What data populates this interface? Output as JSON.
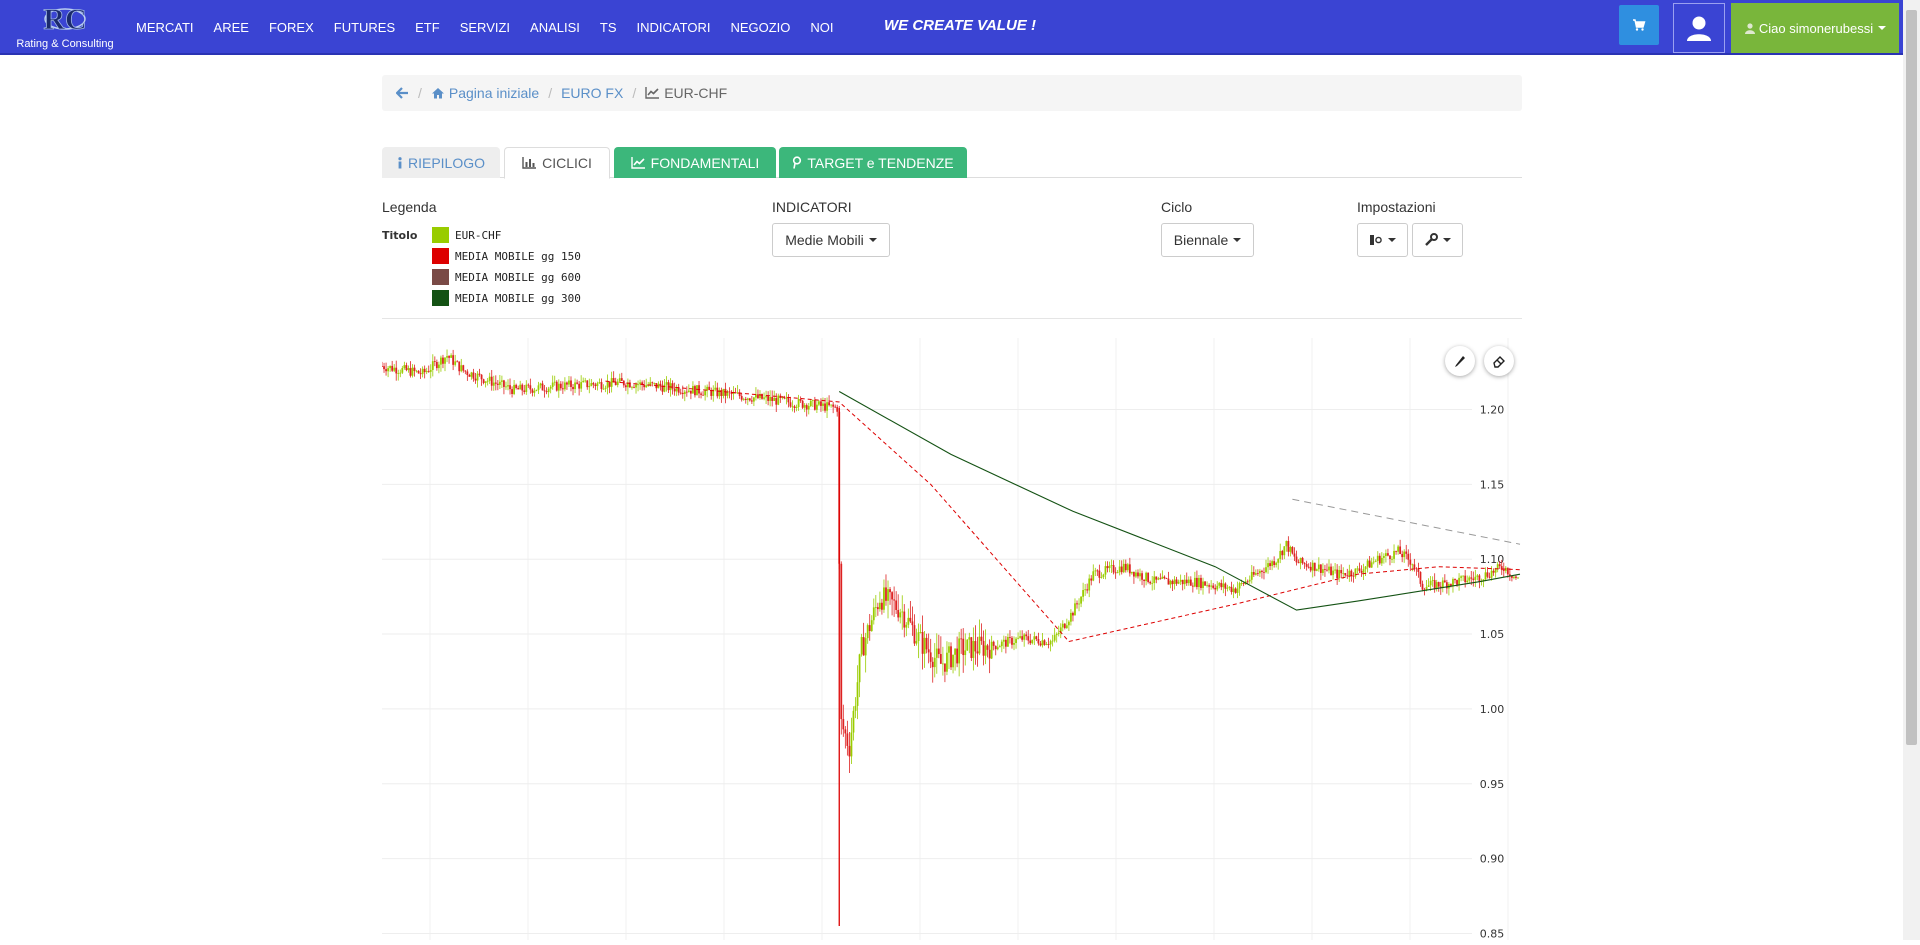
{
  "navbar": {
    "logo_text": "Rating & Consulting",
    "menu": [
      "MERCATI",
      "AREE",
      "FOREX",
      "FUTURES",
      "ETF",
      "SERVIZI",
      "ANALISI",
      "TS",
      "INDICATORI",
      "NEGOZIO",
      "NOI"
    ],
    "slogan": "WE CREATE VALUE !",
    "greeting": "Ciao",
    "username": "simonerubessi",
    "colors": {
      "bar": "#3a44d3",
      "cart": "#2f8fe0",
      "user": "#79b63b"
    }
  },
  "breadcrumb": {
    "home": "Pagina iniziale",
    "section": "EURO FX",
    "current": "EUR-CHF"
  },
  "tabs": [
    {
      "label": "RIEPILOGO",
      "icon": "info-icon"
    },
    {
      "label": "CICLICI",
      "icon": "bar-chart-icon",
      "active": true
    },
    {
      "label": "FONDAMENTALI",
      "icon": "line-chart-icon"
    },
    {
      "label": "TARGET e TENDENZE",
      "icon": "pin-icon"
    }
  ],
  "controls": {
    "legenda_label": "Legenda",
    "titolo_label": "Titolo",
    "legend": [
      {
        "name": "EUR-CHF",
        "color": "#99cc00"
      },
      {
        "name": "MEDIA MOBILE gg 150",
        "color": "#dd0000"
      },
      {
        "name": "MEDIA MOBILE gg 600",
        "color": "#7a4a46"
      },
      {
        "name": "MEDIA MOBILE gg 300",
        "color": "#145214"
      }
    ],
    "indicatori_label": "INDICATORI",
    "indicatori_value": "Medie Mobili",
    "ciclo_label": "Ciclo",
    "ciclo_value": "Biennale",
    "impostazioni_label": "Impostazioni"
  },
  "chart_data": {
    "type": "line",
    "series_name": "EUR-CHF",
    "y_ticks": [
      1.2,
      1.15,
      1.1,
      1.05,
      1.0,
      0.95,
      0.9,
      0.85
    ],
    "y_tick_labels": [
      "1.20",
      "1.15",
      "1.10",
      "1.05",
      "1.00",
      "0.95",
      "0.90",
      "0.85"
    ],
    "ylim": [
      0.85,
      1.245
    ],
    "n": 560,
    "shock_index": 225,
    "shock_low": 0.855,
    "price_anchors": [
      [
        0,
        1.229
      ],
      [
        20,
        1.224
      ],
      [
        32,
        1.236
      ],
      [
        40,
        1.226
      ],
      [
        55,
        1.218
      ],
      [
        65,
        1.213
      ],
      [
        90,
        1.216
      ],
      [
        120,
        1.218
      ],
      [
        160,
        1.212
      ],
      [
        200,
        1.205
      ],
      [
        224,
        1.201
      ],
      [
        226,
        0.99
      ],
      [
        230,
        0.975
      ],
      [
        236,
        1.04
      ],
      [
        245,
        1.075
      ],
      [
        255,
        1.067
      ],
      [
        265,
        1.045
      ],
      [
        275,
        1.03
      ],
      [
        285,
        1.04
      ],
      [
        300,
        1.042
      ],
      [
        315,
        1.047
      ],
      [
        330,
        1.045
      ],
      [
        340,
        1.065
      ],
      [
        350,
        1.09
      ],
      [
        365,
        1.095
      ],
      [
        380,
        1.085
      ],
      [
        400,
        1.085
      ],
      [
        420,
        1.08
      ],
      [
        430,
        1.09
      ],
      [
        440,
        1.1
      ],
      [
        445,
        1.11
      ],
      [
        450,
        1.098
      ],
      [
        460,
        1.095
      ],
      [
        470,
        1.09
      ],
      [
        480,
        1.092
      ],
      [
        490,
        1.1
      ],
      [
        500,
        1.105
      ],
      [
        507,
        1.098
      ],
      [
        512,
        1.082
      ],
      [
        520,
        1.083
      ],
      [
        540,
        1.088
      ],
      [
        552,
        1.095
      ],
      [
        560,
        1.085
      ]
    ],
    "ma150": [
      [
        110,
        1.219
      ],
      [
        225,
        1.205
      ],
      [
        270,
        1.15
      ],
      [
        338,
        1.045
      ],
      [
        420,
        1.07
      ],
      [
        480,
        1.09
      ],
      [
        520,
        1.095
      ],
      [
        560,
        1.093
      ]
    ],
    "ma300": [
      [
        225,
        1.212
      ],
      [
        280,
        1.17
      ],
      [
        340,
        1.132
      ],
      [
        410,
        1.095
      ],
      [
        450,
        1.066
      ],
      [
        480,
        1.072
      ],
      [
        540,
        1.085
      ],
      [
        560,
        1.09
      ]
    ],
    "trendline": [
      [
        448,
        1.14
      ],
      [
        560,
        1.11
      ]
    ]
  }
}
